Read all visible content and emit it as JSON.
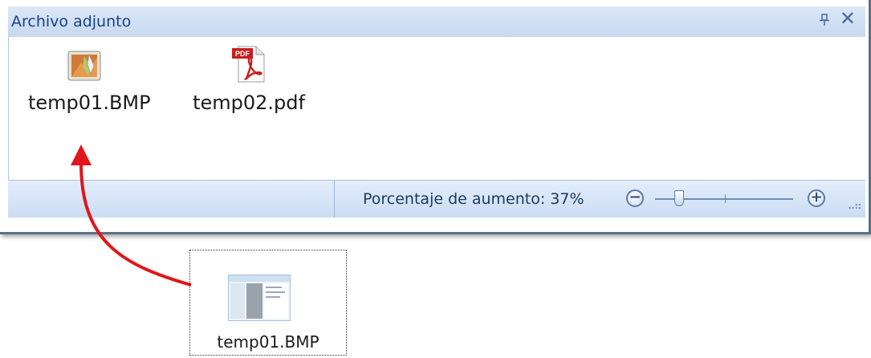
{
  "pane": {
    "title": "Archivo adjunto",
    "close_glyph": "✕",
    "pin_glyph": "⊥"
  },
  "attachments": [
    {
      "name": "temp01.BMP",
      "icon": "bitmap-image-icon"
    },
    {
      "name": "temp02.pdf",
      "icon": "pdf-document-icon",
      "badge": "PDF"
    }
  ],
  "statusbar": {
    "zoom_label": "Porcentaje de aumento: 37%",
    "zoom_percent": 37,
    "zoom_out_glyph": "−",
    "zoom_in_glyph": "+"
  },
  "drag_item": {
    "name": "temp01.BMP"
  },
  "colors": {
    "arrow": "#e0161b",
    "title_text": "#15428b",
    "pdf_red": "#c81e1e"
  }
}
